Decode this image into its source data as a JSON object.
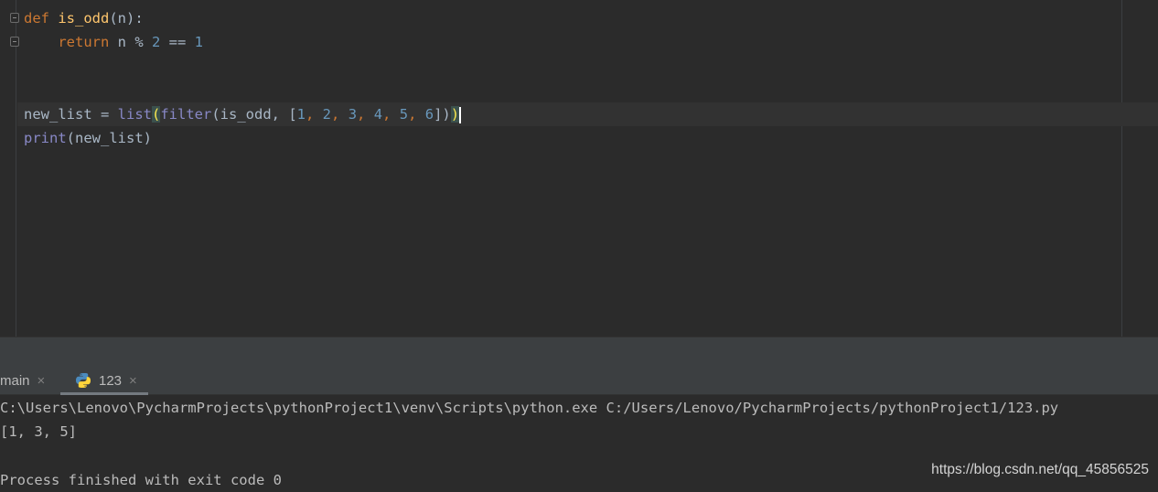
{
  "editor": {
    "lines": {
      "l1": {
        "kw": "def",
        "fn": "is_odd",
        "rest": "(n):"
      },
      "l2": {
        "kw": "return",
        "a": " n % ",
        "n1": "2",
        "b": " == ",
        "n2": "1"
      },
      "l3": {
        "var": "new_list = ",
        "list": "list",
        "open": "(",
        "filter": "filter",
        "args": "(is_odd, [",
        "n1": "1",
        "c1": ", ",
        "n2": "2",
        "c2": ", ",
        "n3": "3",
        "c3": ", ",
        "n4": "4",
        "c4": ", ",
        "n5": "5",
        "c5": ", ",
        "n6": "6",
        "close_inner": "])",
        "close": ")"
      },
      "l4": {
        "print": "print",
        "args": "(new_list)"
      }
    }
  },
  "run_tabs": [
    {
      "label": "main",
      "close": "×"
    },
    {
      "label": "123",
      "close": "×",
      "icon": "python-icon"
    }
  ],
  "console": {
    "command": "C:\\Users\\Lenovo\\PycharmProjects\\pythonProject1\\venv\\Scripts\\python.exe C:/Users/Lenovo/PycharmProjects/pythonProject1/123.py",
    "output": "[1, 3, 5]",
    "exit": "Process finished with exit code 0"
  },
  "watermark": "https://blog.csdn.net/qq_45856525",
  "colors": {
    "background": "#2b2b2b",
    "keyword": "#cc7832",
    "function": "#ffc66d",
    "number": "#6897bb",
    "builtin": "#8888c6",
    "text": "#a9b7c6"
  }
}
